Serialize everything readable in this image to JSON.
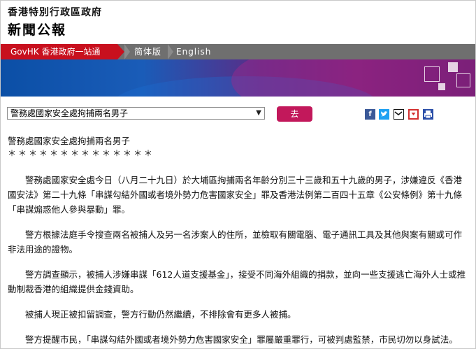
{
  "header": {
    "org_name": "香港特別行政區政府",
    "section_name": "新聞公報"
  },
  "nav": {
    "govhk": "GovHK 香港政府一站通",
    "simplified": "简体版",
    "english": "English"
  },
  "toolbar": {
    "select_value": "警務處國家安全處拘捕兩名男子",
    "go_label": "去",
    "share_icons": [
      "facebook-icon",
      "twitter-icon",
      "email-icon",
      "bookmark-icon",
      "print-icon"
    ]
  },
  "article": {
    "title": "警務處國家安全處拘捕兩名男子",
    "stars": "＊＊＊＊＊＊＊＊＊＊＊＊＊＊",
    "paragraphs": [
      "警務處國家安全處今日（八月二十九日）於大埔區拘捕兩名年齡分別三十三歲和五十九歲的男子，涉嫌違反《香港國安法》第二十九條「串謀勾結外國或者境外勢力危害國家安全」罪及香港法例第二百四十五章《公安條例》第十九條「串謀煽惑他人參與暴動」罪。",
      "警方根據法庭手令搜查兩名被捕人及另一名涉案人的住所，並檢取有關電腦、電子通訊工具及其他與案有關或可作非法用途的證物。",
      "警方調查顯示，被捕人涉嫌串謀「612人道支援基金」，接受不同海外組織的捐款，並向一些支援逃亡海外人士或推動制裁香港的組織提供金錢資助。",
      "被捕人現正被扣留調查，警方行動仍然繼續，不排除會有更多人被捕。",
      "警方提醒市民，「串謀勾結外國或者境外勢力危害國家安全」罪屬嚴重罪行，可被判處監禁，市民切勿以身試法。"
    ]
  },
  "colors": {
    "govhk_red": "#c8101e",
    "nav_grey": "#6f6f6f",
    "go_button": "#c2185b",
    "facebook": "#3b5998",
    "twitter": "#1da1f2"
  }
}
